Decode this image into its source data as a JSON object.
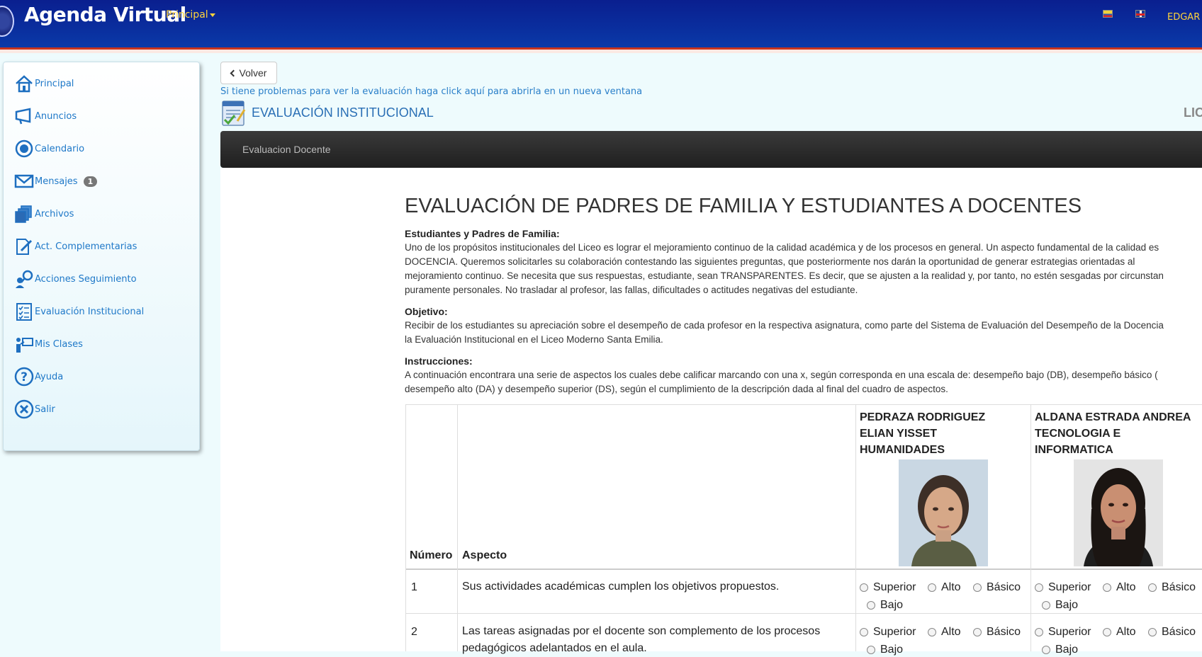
{
  "header": {
    "brand": "Agenda Virtual",
    "menu_principal": "Principal",
    "user": "EDGAR A",
    "flags": [
      "flag-es",
      "flag-en"
    ]
  },
  "sidebar": {
    "items": [
      {
        "label": "Principal",
        "icon": "home-icon"
      },
      {
        "label": "Anuncios",
        "icon": "megaphone-icon"
      },
      {
        "label": "Calendario",
        "icon": "target-icon"
      },
      {
        "label": "Mensajes",
        "icon": "envelope-icon",
        "badge": "1"
      },
      {
        "label": "Archivos",
        "icon": "files-icon"
      },
      {
        "label": "Act. Complementarias",
        "icon": "edit-document-icon"
      },
      {
        "label": "Acciones Seguimiento",
        "icon": "search-people-icon"
      },
      {
        "label": "Evaluación Institucional",
        "icon": "checklist-icon"
      },
      {
        "label": "Mis Clases",
        "icon": "teacher-board-icon"
      },
      {
        "label": "Ayuda",
        "icon": "help-icon"
      },
      {
        "label": "Salir",
        "icon": "close-circle-icon"
      }
    ]
  },
  "main": {
    "back_button": "Volver",
    "help_link": "Si tiene problemas para ver la evaluación haga click aquí para abrirla en un nueva ventana",
    "section_title": "EVALUACIÓN INSTITUCIONAL",
    "section_right": "LIC",
    "tab": "Evaluacion Docente",
    "form_title": "EVALUACIÓN DE PADRES DE FAMILIA Y ESTUDIANTES A DOCENTES",
    "intro_label": "Estudiantes y Padres de Familia:",
    "intro_lines": [
      "Uno de los propósitos institucionales del Liceo es lograr el mejoramiento continuo de la calidad académica y de los procesos en general. Un aspecto fundamental de la calidad es",
      "DOCENCIA. Queremos solicitarles su colaboración contestando las siguientes preguntas, que posteriormente nos darán la oportunidad de generar estrategias orientadas al",
      "mejoramiento continuo. Se necesita que sus respuestas, estudiante, sean TRANSPARENTES. Es decir, que se ajusten a la realidad y, por tanto, no estén sesgadas por circunstan",
      "puramente personales. No trasladar al profesor, las fallas, dificultades o actitudes negativas del estudiante."
    ],
    "objective_label": "Objetivo:",
    "objective_lines": [
      "Recibir de los estudiantes su apreciación sobre el desempeño de cada profesor en la respectiva asignatura, como parte del Sistema de Evaluación del Desempeño de la Docencia",
      "la Evaluación Institucional en el Liceo Moderno Santa Emilia."
    ],
    "instructions_label": "Instrucciones:",
    "instructions_lines": [
      "A continuación encontrara una serie de aspectos los cuales debe calificar marcando con una x, según corresponda en una escala de: desempeño bajo (DB), desempeño básico (",
      "desempeño alto (DA) y desempeño superior (DS), según el cumplimiento de la descripción dada al final del cuadro de aspectos."
    ],
    "table": {
      "col_numero": "Número",
      "col_aspecto": "Aspecto",
      "teachers": [
        {
          "name_lines": [
            "PEDRAZA RODRIGUEZ",
            "ELIAN YISSET",
            "HUMANIDADES"
          ]
        },
        {
          "name_lines": [
            "ALDANA ESTRADA ANDREA",
            "TECNOLOGIA E",
            "INFORMATICA"
          ]
        }
      ],
      "options": [
        "Superior",
        "Alto",
        "Básico",
        "Bajo"
      ],
      "rows": [
        {
          "num": "1",
          "aspect_lines": [
            "Sus actividades académicas cumplen los objetivos propuestos."
          ]
        },
        {
          "num": "2",
          "aspect_lines": [
            "Las tareas asignadas por el docente son complemento de los procesos",
            "pedagógicos adelantados en el aula."
          ]
        }
      ]
    }
  }
}
